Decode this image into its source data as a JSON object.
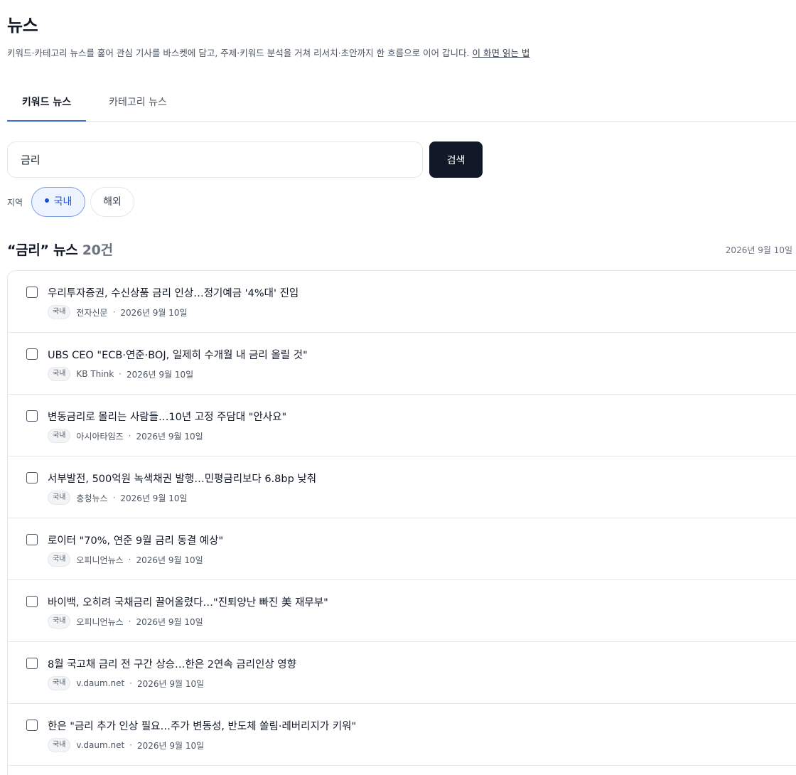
{
  "page": {
    "title": "뉴스",
    "description": "키워드·카테고리 뉴스를 훑어 관심 기사를 바스켓에 담고, 주제·키워드 분석을 거쳐 리서치·초안까지 한 흐름으로 이어 갑니다.",
    "help_link": "이 화면 읽는 법"
  },
  "tabs": [
    {
      "label": "키워드 뉴스",
      "active": true
    },
    {
      "label": "카테고리 뉴스",
      "active": false
    }
  ],
  "search": {
    "value": "금리",
    "button_label": "검색"
  },
  "region": {
    "label": "지역",
    "options": [
      {
        "label": "국내",
        "selected": true
      },
      {
        "label": "해외",
        "selected": false
      }
    ]
  },
  "results": {
    "prefix": "“금리” 뉴스",
    "count_text": "20건",
    "date": "2026년 9월 10일"
  },
  "articles": [
    {
      "title": "우리투자증권, 수신상품 금리 인상…정기예금 '4%대' 진입",
      "tag": "국내",
      "source": "전자신문",
      "date": "2026년 9월 10일"
    },
    {
      "title": "UBS CEO \"ECB·연준·BOJ, 일제히 수개월 내 금리 올릴 것\"",
      "tag": "국내",
      "source": "KB Think",
      "date": "2026년 9월 10일"
    },
    {
      "title": "변동금리로 몰리는 사람들…10년 고정 주담대 \"안사요\"",
      "tag": "국내",
      "source": "아시아타임즈",
      "date": "2026년 9월 10일"
    },
    {
      "title": "서부발전, 500억원 녹색채권 발행…민평금리보다 6.8bp 낮춰",
      "tag": "국내",
      "source": "충청뉴스",
      "date": "2026년 9월 10일"
    },
    {
      "title": "로이터 \"70%, 연준 9월 금리 동결 예상\"",
      "tag": "국내",
      "source": "오피니언뉴스",
      "date": "2026년 9월 10일"
    },
    {
      "title": "바이백, 오히려 국채금리 끌어올렸다…\"진퇴양난 빠진 美 재무부\"",
      "tag": "국내",
      "source": "오피니언뉴스",
      "date": "2026년 9월 10일"
    },
    {
      "title": "8월 국고채 금리 전 구간 상승…한은 2연속 금리인상 영향",
      "tag": "국내",
      "source": "v.daum.net",
      "date": "2026년 9월 10일"
    },
    {
      "title": "한은 \"금리 추가 인상 필요…주가 변동성, 반도체 쏠림·레버리지가 키워\"",
      "tag": "국내",
      "source": "v.daum.net",
      "date": "2026년 9월 10일"
    }
  ],
  "colors": {
    "accent": "#3b6fd8",
    "button_dark": "#111827",
    "border": "#e5e7eb"
  }
}
